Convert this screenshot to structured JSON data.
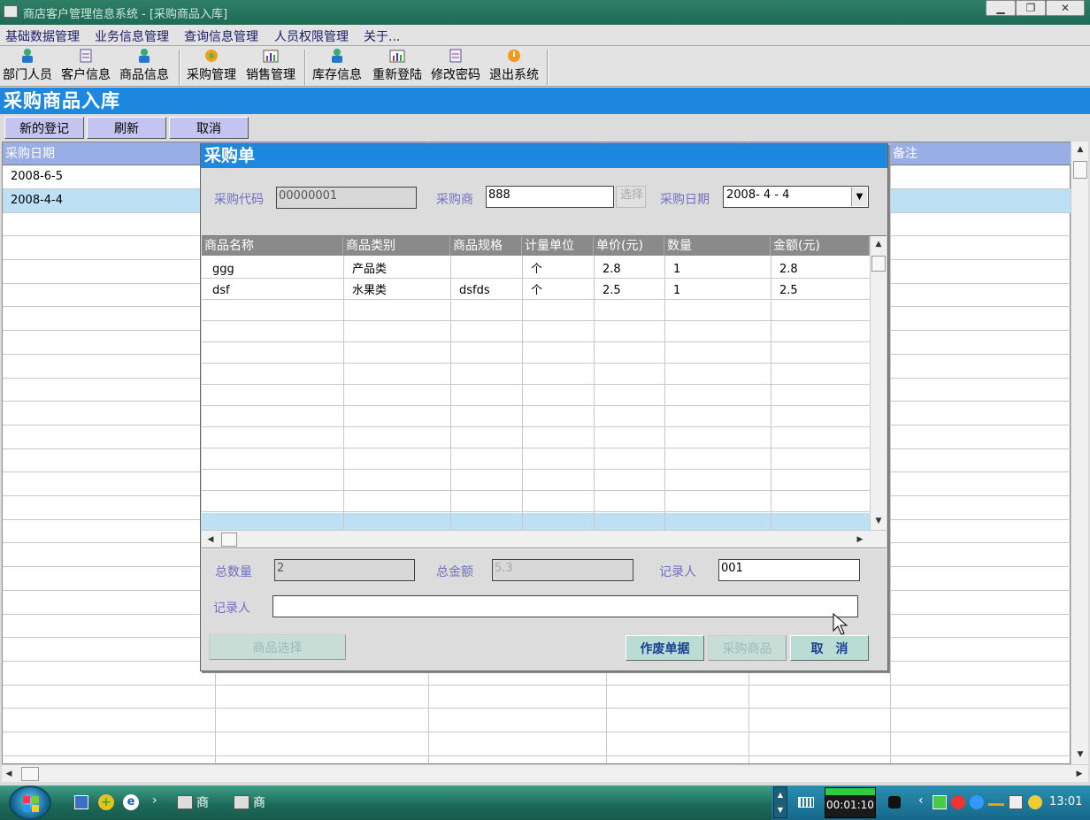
{
  "window": {
    "title": "商店客户管理信息系统 - [采购商品入库]"
  },
  "menu": {
    "items": [
      "基础数据管理",
      "业务信息管理",
      "查询信息管理",
      "人员权限管理",
      "关于..."
    ]
  },
  "toolbar": {
    "items": [
      {
        "label": "部门人员",
        "icon": "user-icon"
      },
      {
        "label": "客户信息",
        "icon": "document-icon"
      },
      {
        "label": "商品信息",
        "icon": "user-icon"
      },
      {
        "label": "采购管理",
        "icon": "shop-icon"
      },
      {
        "label": "销售管理",
        "icon": "chart-icon"
      },
      {
        "label": "库存信息",
        "icon": "user-icon"
      },
      {
        "label": "重新登陆",
        "icon": "chart-icon"
      },
      {
        "label": "修改密码",
        "icon": "document-icon"
      },
      {
        "label": "退出系统",
        "icon": "exit-icon"
      }
    ]
  },
  "page": {
    "title": "采购商品入库"
  },
  "actions": {
    "new_label": "新的登记",
    "refresh_label": "刷新",
    "cancel_label": "取消"
  },
  "main_table": {
    "columns": [
      "采购日期",
      "备注"
    ],
    "rows": [
      "2008-6-5",
      "2008-4-4"
    ]
  },
  "dialog": {
    "title": "采购单",
    "code_label": "采购代码",
    "code_value": "00000001",
    "supplier_label": "采购商",
    "supplier_value": "888",
    "select_label": "选择",
    "date_label": "采购日期",
    "date_value": "2008- 4 - 4",
    "columns": [
      "商品名称",
      "商品类别",
      "商品规格",
      "计量单位",
      "单价(元)",
      "数量",
      "金额(元)"
    ],
    "rows": [
      [
        "ggg",
        "产品类",
        "",
        "个",
        "2.8",
        "1",
        "2.8"
      ],
      [
        "dsf",
        "水果类",
        "dsfds",
        "个",
        "2.5",
        "1",
        "2.5"
      ]
    ],
    "total_qty_label": "总数量",
    "total_qty_value": "2",
    "total_amount_label": "总金额",
    "total_amount_value": "5.3",
    "recorder_label": "记录人",
    "recorder_value": "001",
    "remark_label": "记录人",
    "remark_value": "",
    "product_select_label": "商品选择",
    "void_label": "作废单据",
    "purchase_label": "采购商品",
    "cancel_label": "取　消"
  },
  "taskbar": {
    "tasks": [
      "商",
      "商"
    ],
    "timer": "00:01:10",
    "clock": "13:01"
  },
  "colors": {
    "accent": "#1e88e0",
    "header": "#9aaee6",
    "selected_row": "#bde0f5",
    "taskbar": "#1d6b5a"
  }
}
